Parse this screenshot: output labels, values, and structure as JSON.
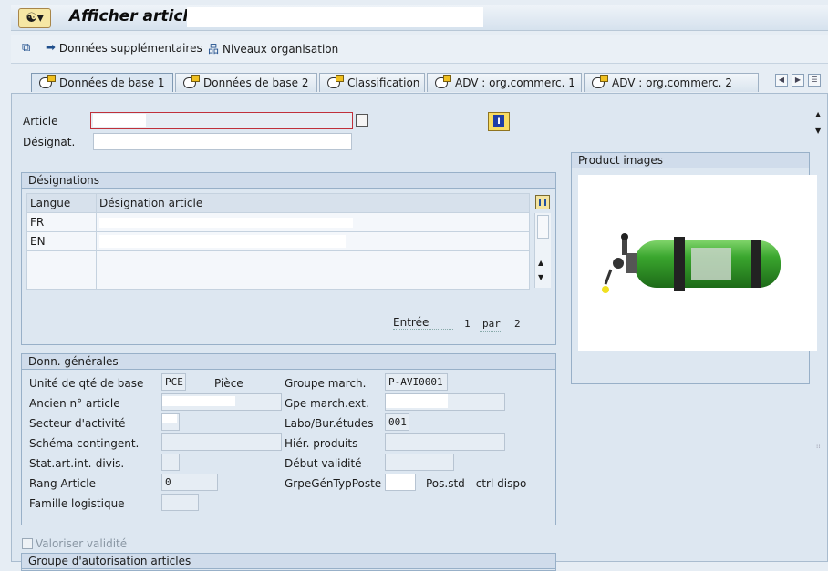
{
  "window": {
    "title": "Afficher article",
    "title_field_value": ""
  },
  "toolbar": {
    "items": [
      {
        "label": ""
      },
      {
        "label": "Données supplémentaires"
      },
      {
        "label": "Niveaux organisation"
      }
    ]
  },
  "tabs": [
    {
      "label": "Données de base 1"
    },
    {
      "label": "Données de base 2"
    },
    {
      "label": "Classification"
    },
    {
      "label": "ADV : org.commerc. 1"
    },
    {
      "label": "ADV : org.commerc. 2"
    }
  ],
  "header_fields": {
    "article_label": "Article",
    "article_value": "",
    "designat_label": "Désignat.",
    "designat_value": ""
  },
  "designations": {
    "title": "Désignations",
    "columns": [
      "Langue",
      "Désignation article"
    ],
    "rows": [
      {
        "lang": "FR",
        "text": ""
      },
      {
        "lang": "EN",
        "text": ""
      },
      {
        "lang": "",
        "text": ""
      },
      {
        "lang": "",
        "text": ""
      }
    ],
    "entry_label": "Entrée",
    "entry_current": "1",
    "entry_of": "par",
    "entry_total": "2"
  },
  "general": {
    "title": "Donn. générales",
    "base_unit_label": "Unité de qté de base",
    "base_unit_value": "PCE",
    "base_unit_text": "Pièce",
    "matl_group_label": "Groupe march.",
    "matl_group_value": "P-AVI0001",
    "old_article_label": "Ancien n° article",
    "old_article_value": "",
    "ext_group_label": "Gpe march.ext.",
    "ext_group_value": "",
    "division_label": "Secteur d'activité",
    "division_value": "",
    "lab_label": "Labo/Bur.études",
    "lab_value": "001",
    "schema_label": "Schéma contingent.",
    "schema_value": "",
    "hier_label": "Hiér. produits",
    "hier_value": "",
    "stat_label": "Stat.art.int.-divis.",
    "stat_value": "",
    "valid_from_label": "Début validité",
    "valid_from_value": "",
    "rang_label": "Rang Article",
    "rang_value": "0",
    "item_cat_label": "GrpeGénTypPoste",
    "item_cat_value": "",
    "item_cat_text": "Pos.std - ctrl dispo",
    "family_label": "Famille logistique",
    "family_value": ""
  },
  "valoriser": {
    "label": "Valoriser validité"
  },
  "auth_group": {
    "title": "Groupe d'autorisation articles"
  },
  "images": {
    "title": "Product images"
  }
}
